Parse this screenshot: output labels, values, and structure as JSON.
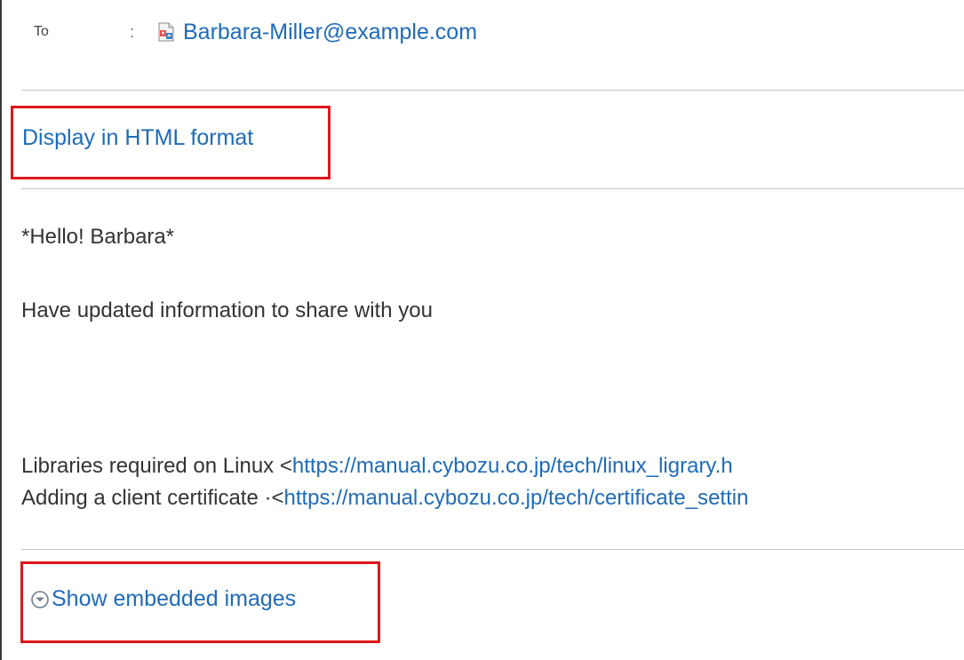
{
  "header": {
    "to_label": "To",
    "colon": ":",
    "to_address": "Barbara-Miller@example.com",
    "address_icon": "address-book-icon"
  },
  "actions": {
    "display_html_label": "Display in HTML format",
    "show_images_label": "Show embedded images",
    "show_images_icon": "chevron-down-circle-icon"
  },
  "message": {
    "greeting": "*Hello! Barbara*",
    "intro": "Have updated information to share with you",
    "lines": [
      {
        "prefix": "Libraries required on Linux <",
        "link": "https://manual.cybozu.co.jp/tech/linux_ligrary.h"
      },
      {
        "prefix": "Adding a client certificate ·<",
        "link": "https://manual.cybozu.co.jp/tech/certificate_settin"
      }
    ]
  },
  "colors": {
    "link": "#1f6bb8",
    "highlight": "#e0161d",
    "text": "#333333",
    "divider": "#c8c8c8"
  }
}
